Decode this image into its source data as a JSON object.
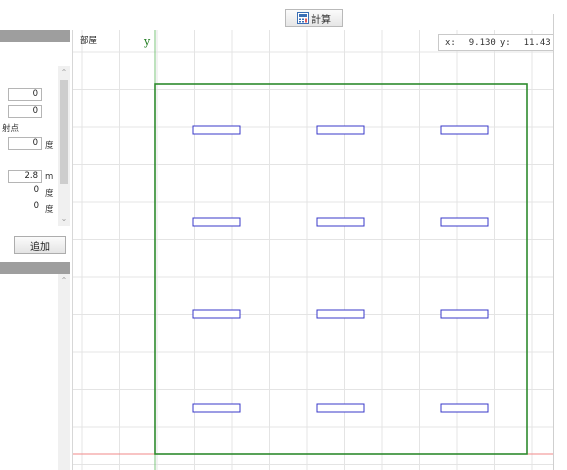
{
  "toolbar": {
    "calc_label": "計算"
  },
  "left_panel": {
    "field1": "0",
    "field2": "0",
    "section_label": "射点",
    "angle_value": "0",
    "angle_unit": "度",
    "height_value": "2.8",
    "height_unit": "m",
    "angle2_value": "0",
    "angle2_unit": "度",
    "angle3_value": "0",
    "angle3_unit": "度",
    "add_label": "追加"
  },
  "canvas": {
    "room_label": "部屋",
    "y_axis_label": "y",
    "coord_x_label": "x:",
    "coord_x_value": "9.130",
    "coord_y_label": "y:",
    "coord_y_value": "11.43",
    "luminaire_rows": 4,
    "luminaire_cols": 3
  },
  "colors": {
    "room_outline": "#2e8b2e",
    "luminaire": "#3838c8",
    "axis_x": "#f08a8a",
    "axis_y": "#7cc47c",
    "grid": "#e4e4e4",
    "panel_header": "#9e9e9e"
  }
}
